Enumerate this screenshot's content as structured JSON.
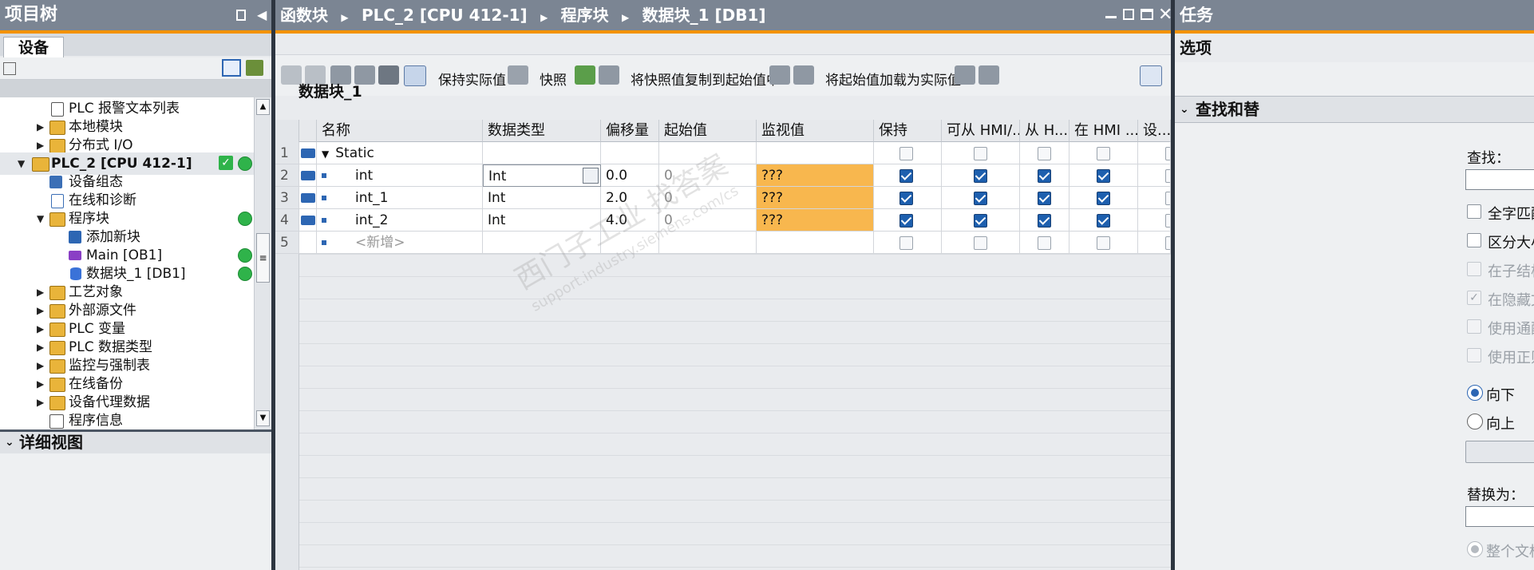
{
  "left_panel": {
    "title": "项目树",
    "tab": "设备",
    "tree": [
      {
        "label": "PLC 报警文本列表",
        "expand": "",
        "indent": 1
      },
      {
        "label": "本地模块",
        "expand": "▶",
        "indent": 1
      },
      {
        "label": "分布式 I/O",
        "expand": "▶",
        "indent": 1
      },
      {
        "label": "PLC_2 [CPU 412-1]",
        "expand": "▼",
        "indent": 0
      },
      {
        "label": "设备组态",
        "expand": "",
        "indent": 1
      },
      {
        "label": "在线和诊断",
        "expand": "",
        "indent": 1
      },
      {
        "label": "程序块",
        "expand": "▼",
        "indent": 1
      },
      {
        "label": "添加新块",
        "expand": "",
        "indent": 2
      },
      {
        "label": "Main [OB1]",
        "expand": "",
        "indent": 2
      },
      {
        "label": "数据块_1 [DB1]",
        "expand": "",
        "indent": 2
      },
      {
        "label": "工艺对象",
        "expand": "▶",
        "indent": 1
      },
      {
        "label": "外部源文件",
        "expand": "▶",
        "indent": 1
      },
      {
        "label": "PLC 变量",
        "expand": "▶",
        "indent": 1
      },
      {
        "label": "PLC 数据类型",
        "expand": "▶",
        "indent": 1
      },
      {
        "label": "监控与强制表",
        "expand": "▶",
        "indent": 1
      },
      {
        "label": "在线备份",
        "expand": "▶",
        "indent": 1
      },
      {
        "label": "设备代理数据",
        "expand": "▶",
        "indent": 1
      },
      {
        "label": "程序信息",
        "expand": "",
        "indent": 1
      }
    ],
    "detail_view": "详细视图"
  },
  "editor": {
    "breadcrumb": [
      "函数块",
      "PLC_2 [CPU 412-1]",
      "程序块",
      "数据块_1 [DB1]"
    ],
    "toolbar": {
      "keep_actual": "保持实际值",
      "snapshot": "快照",
      "copy_snapshot": "将快照值复制到起始值中",
      "load_start": "将起始值加载为实际值"
    },
    "block_name": "数据块_1",
    "columns": [
      "名称",
      "数据类型",
      "偏移量",
      "起始值",
      "监视值",
      "保持",
      "可从 HMI/...",
      "从 H...",
      "在 HMI ...",
      "设..."
    ],
    "rows": [
      {
        "num": "1",
        "name": "Static",
        "type": "",
        "offset": "",
        "start": "",
        "monitor": "",
        "checks": [
          false,
          false,
          false,
          false
        ]
      },
      {
        "num": "2",
        "name": "int",
        "type": "Int",
        "offset": "0.0",
        "start": "0",
        "monitor": "???",
        "checks": [
          true,
          true,
          true,
          true
        ]
      },
      {
        "num": "3",
        "name": "int_1",
        "type": "Int",
        "offset": "2.0",
        "start": "0",
        "monitor": "???",
        "checks": [
          true,
          true,
          true,
          true
        ]
      },
      {
        "num": "4",
        "name": "int_2",
        "type": "Int",
        "offset": "4.0",
        "start": "0",
        "monitor": "???",
        "checks": [
          true,
          true,
          true,
          true
        ]
      },
      {
        "num": "5",
        "name": "<新增>",
        "type": "",
        "offset": "",
        "start": "",
        "monitor": "",
        "checks": [
          false,
          false,
          false,
          false
        ]
      }
    ]
  },
  "right_panel": {
    "title": "任务",
    "options": "选项",
    "section": "查找和替",
    "find_label": "查找：",
    "checkboxes": [
      {
        "label": "全字匹配",
        "checked": false,
        "disabled": false
      },
      {
        "label": "区分大小",
        "checked": false,
        "disabled": false
      },
      {
        "label": "在子结构",
        "checked": false,
        "disabled": true
      },
      {
        "label": "在隐藏文",
        "checked": true,
        "disabled": true
      },
      {
        "label": "使用通配",
        "checked": false,
        "disabled": true
      },
      {
        "label": "使用正则",
        "checked": false,
        "disabled": true
      }
    ],
    "radio_down": "向下",
    "radio_up": "向上",
    "replace_label": "替换为：",
    "whole_doc": "整个文档"
  },
  "watermark": {
    "line1": "西门子工业  找答案",
    "line2": "support.industry.siemens.com/cs"
  },
  "colors": {
    "accent": "#f39200",
    "monitor_bg": "#f8b74e",
    "titlebar": "#7b8593",
    "check_blue": "#1d5fae",
    "status_green": "#2fb34a"
  }
}
